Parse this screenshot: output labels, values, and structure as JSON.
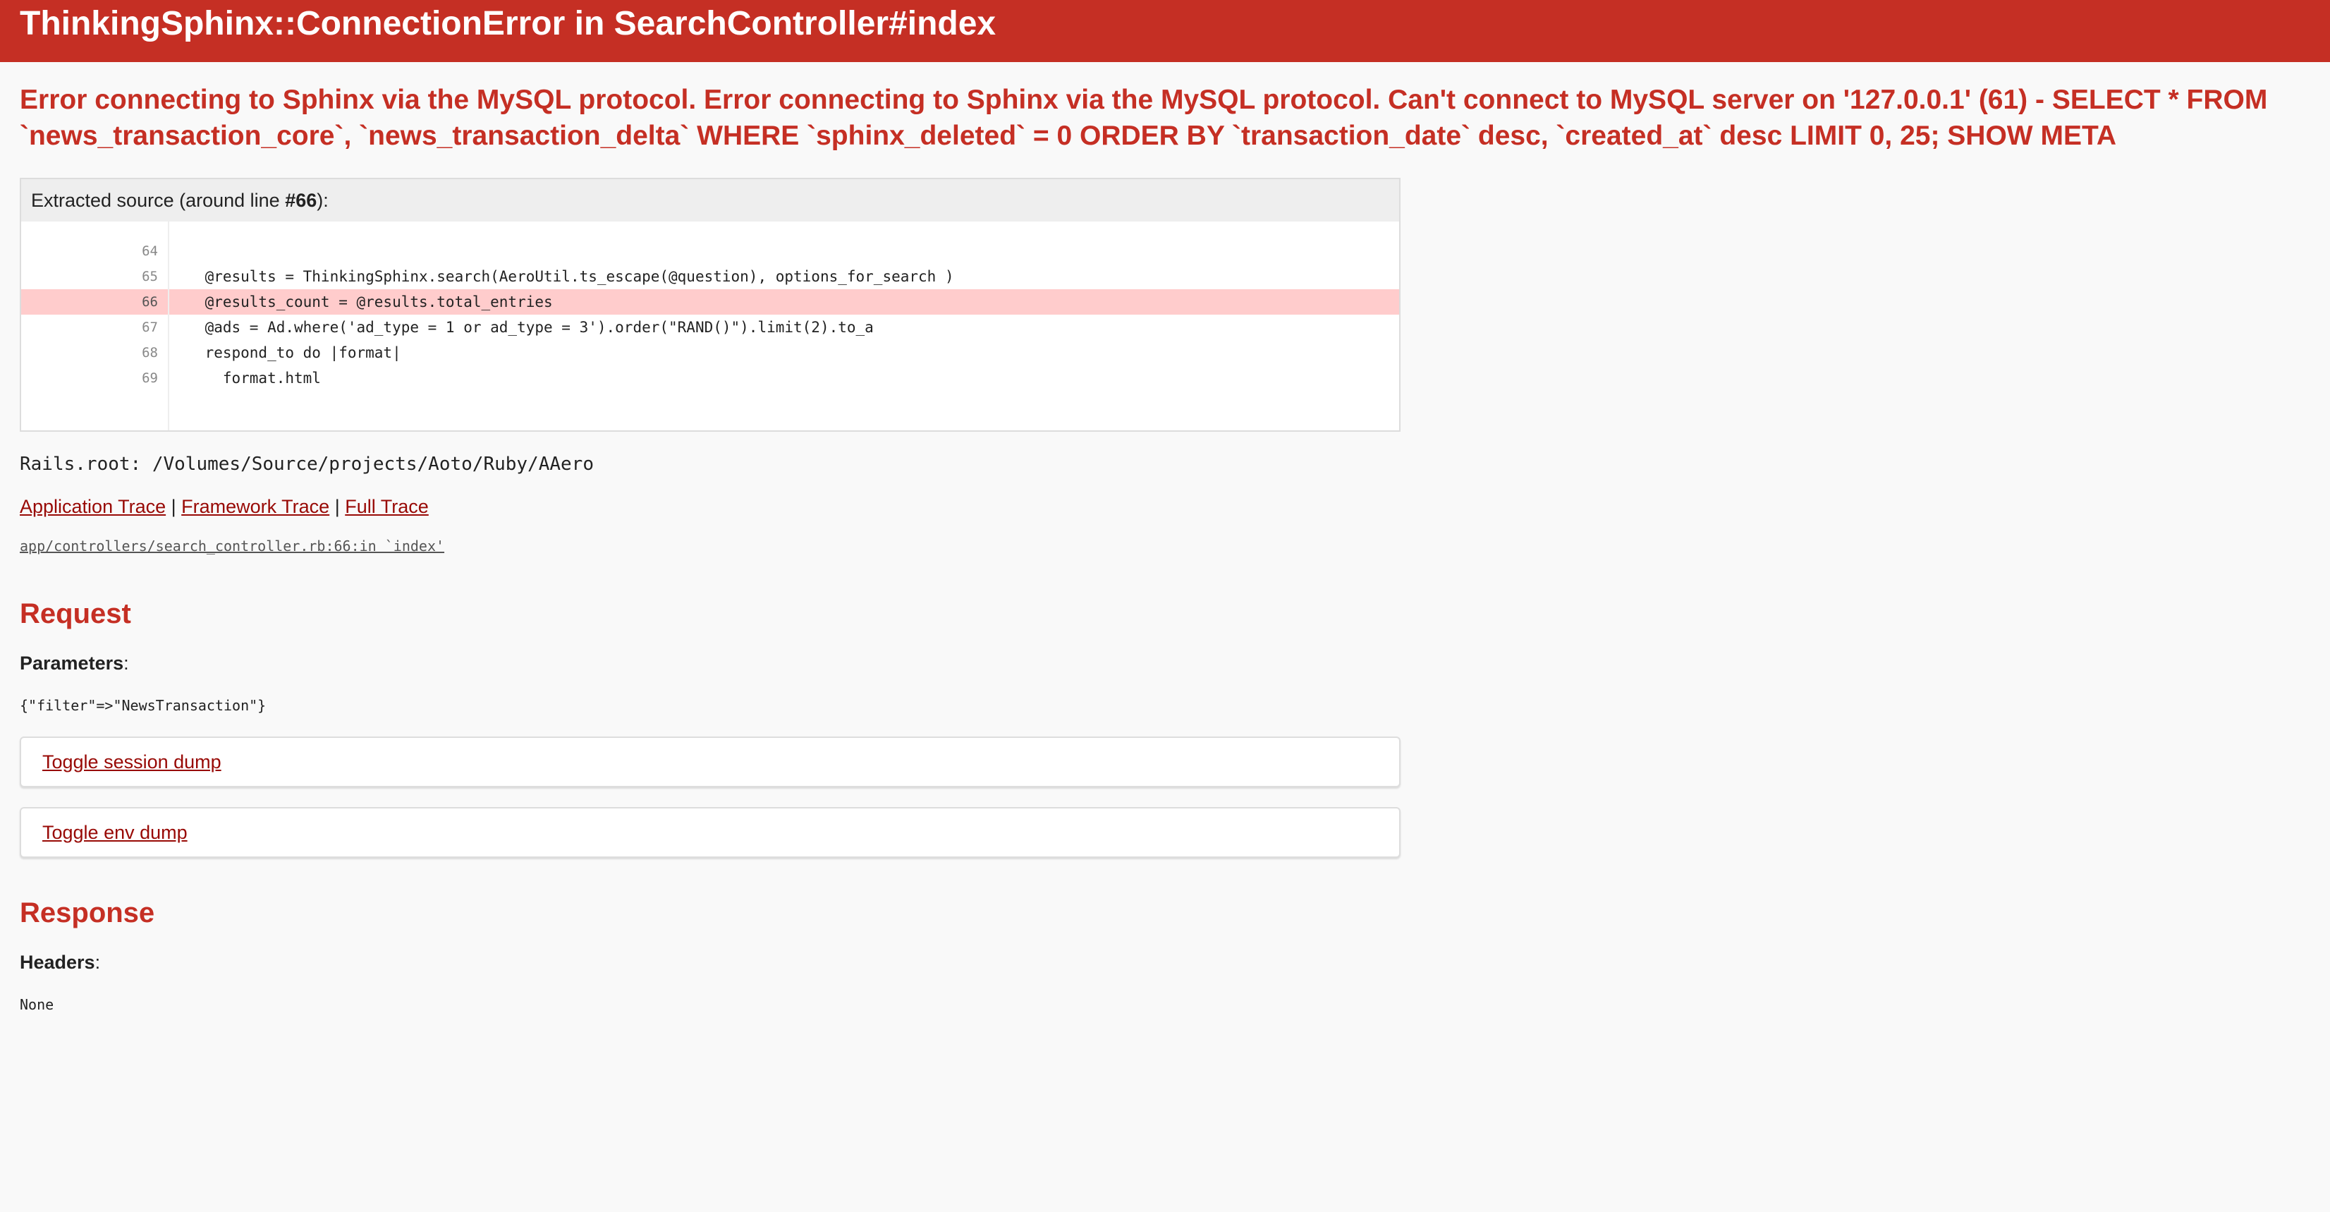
{
  "header": {
    "title": "ThinkingSphinx::ConnectionError in SearchController#index"
  },
  "error_message": "Error connecting to Sphinx via the MySQL protocol. Error connecting to Sphinx via the MySQL protocol. Can't connect to MySQL server on '127.0.0.1' (61) - SELECT * FROM `news_transaction_core`, `news_transaction_delta` WHERE `sphinx_deleted` = 0 ORDER BY `transaction_date` desc, `created_at` desc LIMIT 0, 25; SHOW META",
  "source": {
    "header_prefix": "Extracted source (around line ",
    "header_line": "#66",
    "header_suffix": "):",
    "lines": [
      {
        "num": "64",
        "code": ""
      },
      {
        "num": "65",
        "code": "    @results = ThinkingSphinx.search(AeroUtil.ts_escape(@question), options_for_search )"
      },
      {
        "num": "66",
        "code": "    @results_count = @results.total_entries"
      },
      {
        "num": "67",
        "code": "    @ads = Ad.where('ad_type = 1 or ad_type = 3').order(\"RAND()\").limit(2).to_a"
      },
      {
        "num": "68",
        "code": "    respond_to do |format|"
      },
      {
        "num": "69",
        "code": "      format.html"
      }
    ]
  },
  "rails_root": "Rails.root: /Volumes/Source/projects/Aoto/Ruby/AAero",
  "trace": {
    "application": "Application Trace",
    "separator": " | ",
    "framework": "Framework Trace",
    "full": "Full Trace",
    "line": "app/controllers/search_controller.rb:66:in `index'"
  },
  "request": {
    "title": "Request",
    "params_label": "Parameters",
    "params_value": "{\"filter\"=>\"NewsTransaction\"}",
    "toggle_session": "Toggle session dump",
    "toggle_env": "Toggle env dump"
  },
  "response": {
    "title": "Response",
    "headers_label": "Headers",
    "headers_value": "None"
  },
  "colors": {
    "brand_red": "#c52f24",
    "link": "#980905",
    "highlight": "#ffcccc"
  }
}
